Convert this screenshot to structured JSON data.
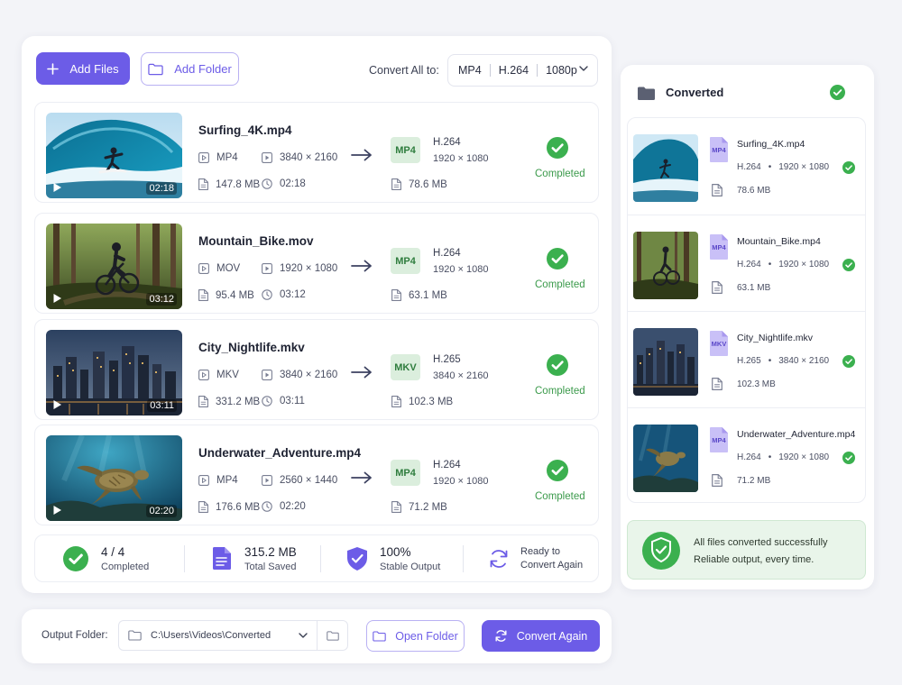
{
  "toolbar": {
    "add_files_label": "Add Files",
    "add_folder_label": "Add Folder",
    "convert_all_label": "Convert All to:",
    "format": "MP4",
    "codec": "H.264",
    "resolution": "1080p"
  },
  "files": [
    {
      "name": "Surfing_4K.mp4",
      "in_format": "MP4",
      "in_resolution": "3840 × 2160",
      "in_size": "147.8 MB",
      "duration": "02:18",
      "out_format": "MP4",
      "out_codec": "H.264",
      "out_resolution": "1920 × 1080",
      "out_size": "78.6 MB",
      "status": "Completed"
    },
    {
      "name": "Mountain_Bike.mov",
      "in_format": "MOV",
      "in_resolution": "1920 × 1080",
      "in_size": "95.4 MB",
      "duration": "03:12",
      "out_format": "MP4",
      "out_codec": "H.264",
      "out_resolution": "1920 × 1080",
      "out_size": "63.1 MB",
      "status": "Completed"
    },
    {
      "name": "City_Nightlife.mkv",
      "in_format": "MKV",
      "in_resolution": "3840 × 2160",
      "in_size": "331.2 MB",
      "duration": "03:11",
      "out_format": "MKV",
      "out_codec": "H.265",
      "out_resolution": "3840 × 2160",
      "out_size": "102.3 MB",
      "status": "Completed"
    },
    {
      "name": "Underwater_Adventure.mp4",
      "in_format": "MP4",
      "in_resolution": "2560 × 1440",
      "in_size": "176.6 MB",
      "duration": "02:20",
      "out_format": "MP4",
      "out_codec": "H.264",
      "out_resolution": "1920 × 1080",
      "out_size": "71.2 MB",
      "status": "Completed"
    }
  ],
  "summary": {
    "completed_value": "4 / 4",
    "completed_label": "Completed",
    "saved_value": "315.2 MB",
    "saved_label": "Total Saved",
    "stable_value": "100%",
    "stable_label": "Stable Output",
    "ready_line1": "Ready to",
    "ready_line2": "Convert Again"
  },
  "bottom_bar": {
    "output_label": "Output Folder:",
    "output_path": "C:\\Users\\Videos\\Converted",
    "open_folder_label": "Open Folder",
    "convert_again_label": "Convert Again"
  },
  "converted": {
    "title": "Converted",
    "items": [
      {
        "name": "Surfing_4K.mp4",
        "badge": "MP4",
        "codec": "H.264",
        "dot": "•",
        "resolution": "1920 × 1080",
        "size": "78.6 MB"
      },
      {
        "name": "Mountain_Bike.mp4",
        "badge": "MP4",
        "codec": "H.264",
        "dot": "•",
        "resolution": "1920 × 1080",
        "size": "63.1 MB"
      },
      {
        "name": "City_Nightlife.mkv",
        "badge": "MKV",
        "codec": "H.265",
        "dot": "•",
        "resolution": "3840 × 2160",
        "size": "102.3 MB"
      },
      {
        "name": "Underwater_Adventure.mp4",
        "badge": "MP4",
        "codec": "H.264",
        "dot": "•",
        "resolution": "1920 × 1080",
        "size": "71.2 MB"
      }
    ],
    "success_title": "All files converted successfully",
    "success_subtitle": "Reliable output, every time."
  },
  "colors": {
    "accent": "#6c5ce7",
    "success": "#3bb04f",
    "success_bg": "#e9f5ea",
    "badge_bg": "#dbeedd"
  }
}
